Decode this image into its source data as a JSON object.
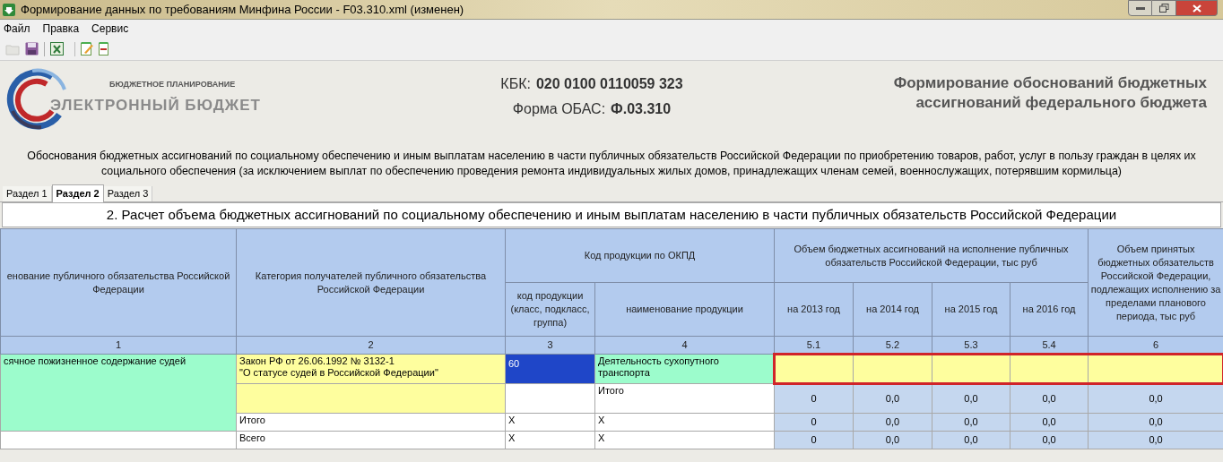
{
  "window": {
    "title": "Формирование данных по требованиям Минфина России - F03.310.xml (изменен)"
  },
  "menu": [
    "Файл",
    "Правка",
    "Сервис"
  ],
  "logo": {
    "subtitle": "БЮДЖЕТНОЕ ПЛАНИРОВАНИЕ",
    "title": "ЭЛЕКТРОННЫЙ БЮДЖЕТ"
  },
  "codes": [
    {
      "label": "КБК:",
      "value": "020 0100 0110059 323"
    },
    {
      "label": "Форма ОБАС:",
      "value": "Ф.03.310"
    }
  ],
  "heading": [
    "Формирование обоснований бюджетных",
    "ассигнований федерального бюджета"
  ],
  "description": "Обоснования бюджетных ассигнований по социальному обеспечению и иным выплатам населению в части публичных обязательств Российской Федерации по приобретению товаров, работ, услуг в пользу граждан в целях их\nсоциального обеспечения (за исключением выплат по обеспечению проведения ремонта индивидуальных жилых домов, принадлежащих членам семей, военнослужащих, потерявшим кормильца)",
  "tabs": [
    {
      "label": "Раздел 1",
      "selected": false
    },
    {
      "label": "Раздел 2",
      "selected": true
    },
    {
      "label": "Раздел 3",
      "selected": false
    }
  ],
  "table": {
    "title": "2. Расчет объема бюджетных ассигнований по социальному обеспечению и иным выплатам населению в части публичных обязательств Российской Федерации",
    "header": {
      "col1": "енование публичного обязательства Российской Федерации",
      "col2": "Категория получателей публичного обязательства Российской Федерации",
      "group1": {
        "title": "Код продукции по ОКПД",
        "sub": [
          "код продукции (класс, подкласс, группа)",
          "наименование продукции"
        ]
      },
      "group2": {
        "title": "Объем бюджетных ассигнований на исполнение публичных обязательств Российской Федерации, тыс руб",
        "sub": [
          "на 2013 год",
          "на 2014 год",
          "на 2015 год",
          "на 2016 год"
        ]
      },
      "col6": "Объем принятых бюджетных обязательств Российской Федерации, подлежащих исполнению за пределами планового периода, тыс руб"
    },
    "numbers": [
      "1",
      "2",
      "3",
      "4",
      "5.1",
      "5.2",
      "5.3",
      "5.4",
      "6"
    ],
    "rows": [
      {
        "outlined": true,
        "cells": [
          {
            "kind": "fixed",
            "text": "сячное пожизненное содержание судей",
            "selected": false,
            "rowspan": 3
          },
          {
            "kind": "editable",
            "text": "Закон РФ от 26.06.1992 № 3132-1\n\"О статусе судей в Российской Федерации\"",
            "selected": false
          },
          {
            "kind": "editable",
            "text": "60",
            "selected": true
          },
          {
            "kind": "fixed",
            "text": "Деятельность сухопутного транспорта",
            "selected": false
          },
          {
            "kind": "editable",
            "selected": false
          },
          {
            "kind": "editable",
            "selected": false
          },
          {
            "kind": "editable",
            "selected": false
          },
          {
            "kind": "editable",
            "selected": false
          },
          {
            "kind": "editable",
            "selected": false
          }
        ]
      },
      {
        "outlined": false,
        "cells": [
          {
            "kind": "editable",
            "selected": false
          },
          {
            "kind": "plain",
            "selected": false
          },
          {
            "kind": "plain",
            "text": "Итого",
            "selected": false
          },
          {
            "kind": "sum",
            "text": "0",
            "selected": false
          },
          {
            "kind": "sum",
            "text": "0,0",
            "selected": false
          },
          {
            "kind": "sum",
            "text": "0,0",
            "selected": false
          },
          {
            "kind": "sum",
            "text": "0,0",
            "selected": false
          },
          {
            "kind": "sum",
            "text": "0,0",
            "selected": false
          }
        ]
      },
      {
        "outlined": false,
        "cells": [
          {
            "kind": "plain",
            "text": "Итого",
            "selected": false
          },
          {
            "kind": "plain",
            "text": "X",
            "selected": false
          },
          {
            "kind": "plain",
            "text": "X",
            "selected": false
          },
          {
            "kind": "sum",
            "text": "0",
            "selected": false
          },
          {
            "kind": "sum",
            "text": "0,0",
            "selected": false
          },
          {
            "kind": "sum",
            "text": "0,0",
            "selected": false
          },
          {
            "kind": "sum",
            "text": "0,0",
            "selected": false
          },
          {
            "kind": "sum",
            "text": "0,0",
            "selected": false
          }
        ]
      },
      {
        "outlined": false,
        "cells": [
          {
            "kind": "plain",
            "selected": false
          },
          {
            "kind": "plain",
            "text": "Всего",
            "selected": false
          },
          {
            "kind": "plain",
            "text": "X",
            "selected": false
          },
          {
            "kind": "plain",
            "text": "X",
            "selected": false
          },
          {
            "kind": "sum",
            "text": "0",
            "selected": false
          },
          {
            "kind": "sum",
            "text": "0,0",
            "selected": false
          },
          {
            "kind": "sum",
            "text": "0,0",
            "selected": false
          },
          {
            "kind": "sum",
            "text": "0,0",
            "selected": false
          },
          {
            "kind": "sum",
            "text": "0,0",
            "selected": false
          }
        ]
      }
    ]
  }
}
